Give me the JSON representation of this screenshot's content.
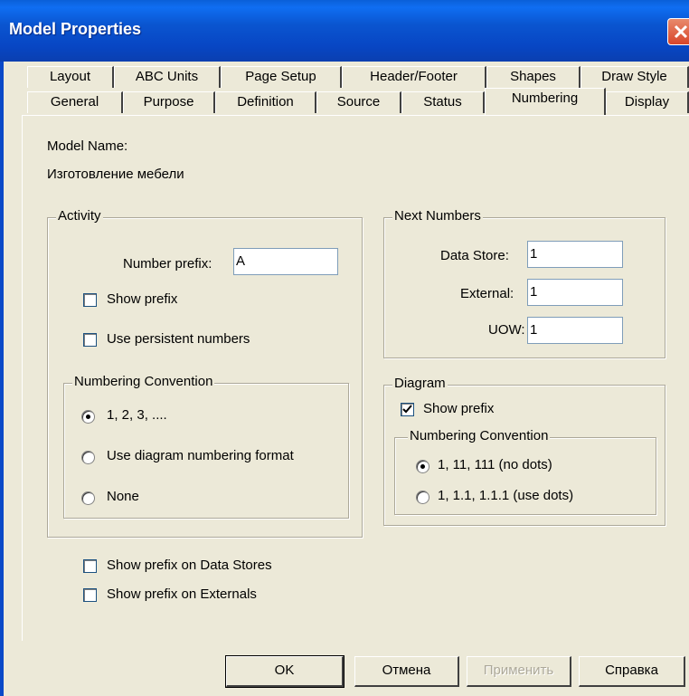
{
  "window": {
    "title": "Model Properties"
  },
  "tabs_row1": [
    "Layout",
    "ABC Units",
    "Page Setup",
    "Header/Footer",
    "Shapes",
    "Draw Style"
  ],
  "tabs_row2": [
    "General",
    "Purpose",
    "Definition",
    "Source",
    "Status",
    "Numbering",
    "Display"
  ],
  "selected_tab": "Numbering",
  "model": {
    "name_label": "Model Name:",
    "name_value": "Изготовление мебели"
  },
  "activity": {
    "group_label": "Activity",
    "number_prefix_label": "Number prefix:",
    "number_prefix_value": "A",
    "show_prefix_label": "Show prefix",
    "show_prefix_checked": false,
    "persistent_label": "Use persistent numbers",
    "persistent_checked": false,
    "convention": {
      "group_label": "Numbering Convention",
      "options": [
        "1, 2, 3, ....",
        "Use diagram numbering format",
        "None"
      ],
      "selected": "1, 2, 3, ...."
    }
  },
  "next_numbers": {
    "group_label": "Next Numbers",
    "data_store_label": "Data Store:",
    "data_store_value": "1",
    "external_label": "External:",
    "external_value": "1",
    "uow_label": "UOW:",
    "uow_value": "1"
  },
  "diagram": {
    "group_label": "Diagram",
    "show_prefix_label": "Show prefix",
    "show_prefix_checked": true,
    "convention": {
      "group_label": "Numbering Convention",
      "options": [
        "1, 11, 111 (no dots)",
        "1, 1.1, 1.1.1 (use dots)"
      ],
      "selected": "1, 11, 111 (no dots)"
    }
  },
  "bottom_checks": {
    "data_stores_label": "Show prefix on Data Stores",
    "externals_label": "Show prefix on Externals"
  },
  "buttons": {
    "ok": "OK",
    "cancel": "Отмена",
    "apply": "Применить",
    "help": "Справка"
  }
}
